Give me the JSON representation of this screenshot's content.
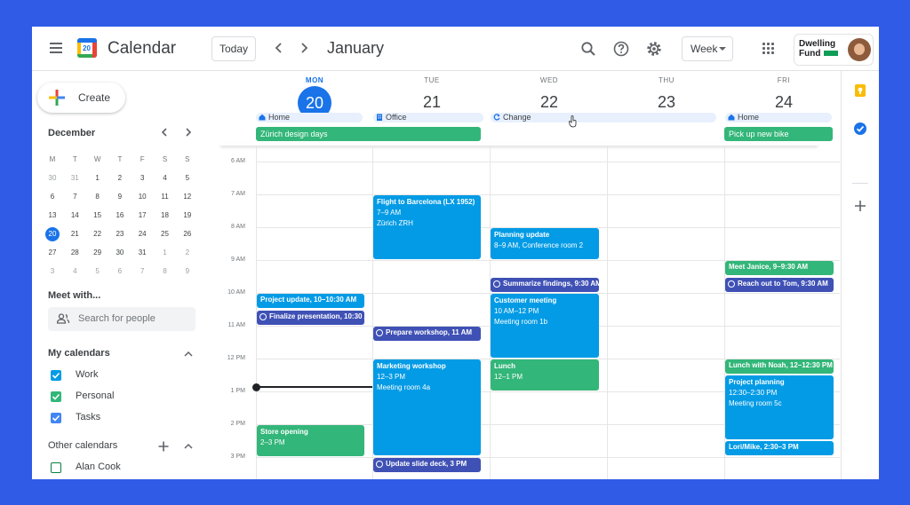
{
  "app": {
    "title": "Calendar",
    "logo_number": "20"
  },
  "header": {
    "today_label": "Today",
    "month": "January",
    "view_label": "Week",
    "org_name_line1": "Dwelling",
    "org_name_line2": "Fund",
    "icons": [
      "menu-icon",
      "search-icon",
      "help-icon",
      "settings-icon",
      "apps-grid-icon"
    ]
  },
  "sidebar": {
    "create_label": "Create",
    "mini_cal": {
      "title": "December",
      "weekday_heads": [
        "M",
        "T",
        "W",
        "T",
        "F",
        "S",
        "S"
      ],
      "weeks": [
        [
          "30",
          "31",
          "1",
          "2",
          "3",
          "4",
          "5"
        ],
        [
          "6",
          "7",
          "8",
          "9",
          "10",
          "11",
          "12"
        ],
        [
          "13",
          "14",
          "15",
          "16",
          "17",
          "18",
          "19"
        ],
        [
          "20",
          "21",
          "22",
          "23",
          "24",
          "25",
          "26"
        ],
        [
          "27",
          "28",
          "29",
          "30",
          "31",
          "1",
          "2"
        ],
        [
          "3",
          "4",
          "5",
          "6",
          "7",
          "8",
          "9"
        ]
      ]
    },
    "meet_title": "Meet with...",
    "search_placeholder": "Search for people",
    "my_calendars_title": "My calendars",
    "my_calendars": [
      {
        "label": "Work",
        "color": "#039be5",
        "checked": true
      },
      {
        "label": "Personal",
        "color": "#33b679",
        "checked": true
      },
      {
        "label": "Tasks",
        "color": "#4285f4",
        "checked": true
      }
    ],
    "other_calendars_title": "Other calendars",
    "other_calendars": [
      {
        "label": "Alan Cook",
        "color": "#0b8043",
        "checked": false
      }
    ]
  },
  "days": [
    {
      "name": "MON",
      "num": "20",
      "active": true
    },
    {
      "name": "TUE",
      "num": "21",
      "active": false
    },
    {
      "name": "WED",
      "num": "22",
      "active": false
    },
    {
      "name": "THU",
      "num": "23",
      "active": false
    },
    {
      "name": "FRI",
      "num": "24",
      "active": false
    }
  ],
  "working_location": [
    {
      "label": "Home"
    },
    {
      "label": "Office"
    },
    {
      "label": "Change"
    },
    {
      "label": "Home"
    }
  ],
  "all_day_events": [
    {
      "title": "Zürich design days"
    },
    {
      "title": "Pick up new bike"
    }
  ],
  "time_labels": [
    "6 AM",
    "7 AM",
    "8 AM",
    "9 AM",
    "10 AM",
    "11 AM",
    "12 PM",
    "1 PM",
    "2 PM",
    "3 PM"
  ],
  "events": {
    "mon_project_update": "Project update, 10–10:30 AM",
    "mon_finalize": "Finalize presentation, 10:30 AM",
    "mon_store_title": "Store opening",
    "mon_store_time": "2–3 PM",
    "tue_flight_title": "Flight to Barcelona (LX 1952)",
    "tue_flight_time": "7–9 AM",
    "tue_flight_place": "Zürich ZRH",
    "tue_prepare": "Prepare workshop, 11 AM",
    "tue_marketing_title": "Marketing workshop",
    "tue_marketing_time": "12–3 PM",
    "tue_marketing_place": "Meeting room 4a",
    "tue_update_deck": "Update slide deck, 3 PM",
    "wed_planning_title": "Planning update",
    "wed_planning_time": "8–9 AM, Conference room 2",
    "wed_summarize": "Summarize findings, 9:30 AM",
    "wed_customer_title": "Customer meeting",
    "wed_customer_time": "10 AM–12 PM",
    "wed_customer_place": "Meeting room 1b",
    "wed_lunch_title": "Lunch",
    "wed_lunch_time": "12–1 PM",
    "fri_janice": "Meet Janice, 9–9:30 AM",
    "fri_tom": "Reach out to Tom, 9:30 AM",
    "fri_noah": "Lunch with Noah, 12–12:30 PM",
    "fri_planning_title": "Project planning",
    "fri_planning_time": "12:30–2:30 PM",
    "fri_planning_place": "Meeting room 5c",
    "fri_lori": "Lori/Mike, 2:30–3 PM"
  },
  "colors": {
    "accent": "#1a73e8",
    "event_blue": "#039be5",
    "event_green": "#33b679",
    "task_indigo": "#3f51b5",
    "frame": "#2f5be6"
  }
}
